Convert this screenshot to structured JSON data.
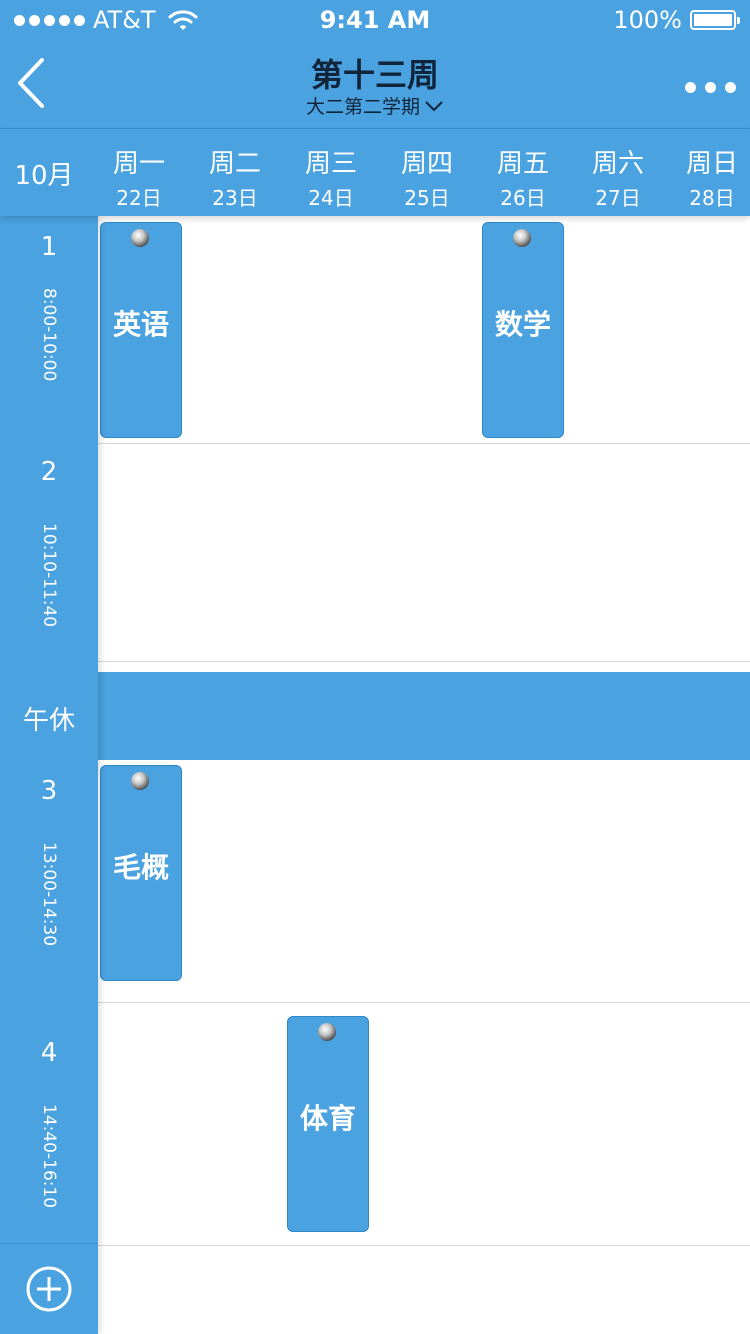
{
  "status_bar": {
    "carrier": "AT&T",
    "time": "9:41 AM",
    "battery": "100%"
  },
  "nav": {
    "title": "第十三周",
    "subtitle": "大二第二学期"
  },
  "header": {
    "month": "10月",
    "days": [
      {
        "name": "周一",
        "date": "22日"
      },
      {
        "name": "周二",
        "date": "23日"
      },
      {
        "name": "周三",
        "date": "24日"
      },
      {
        "name": "周四",
        "date": "25日"
      },
      {
        "name": "周五",
        "date": "26日"
      },
      {
        "name": "周六",
        "date": "27日"
      },
      {
        "name": "周日",
        "date": "28日"
      }
    ]
  },
  "periods": [
    {
      "num": "1",
      "range": "8:00-10:00"
    },
    {
      "num": "2",
      "range": "10:10-11:40"
    },
    {
      "num": "3",
      "range": "13:00-14:30"
    },
    {
      "num": "4",
      "range": "14:40-16:10"
    }
  ],
  "lunch_label": "午休",
  "courses": [
    {
      "name": "英语",
      "day": "周一",
      "period": "1"
    },
    {
      "name": "数学",
      "day": "周五",
      "period": "1"
    },
    {
      "name": "毛概",
      "day": "周一",
      "period": "3"
    },
    {
      "name": "体育",
      "day": "周三",
      "period": "4"
    }
  ],
  "colors": {
    "primary": "#4aa2e0",
    "title_text": "#10243a",
    "grid_line": "#d8d8d8"
  }
}
